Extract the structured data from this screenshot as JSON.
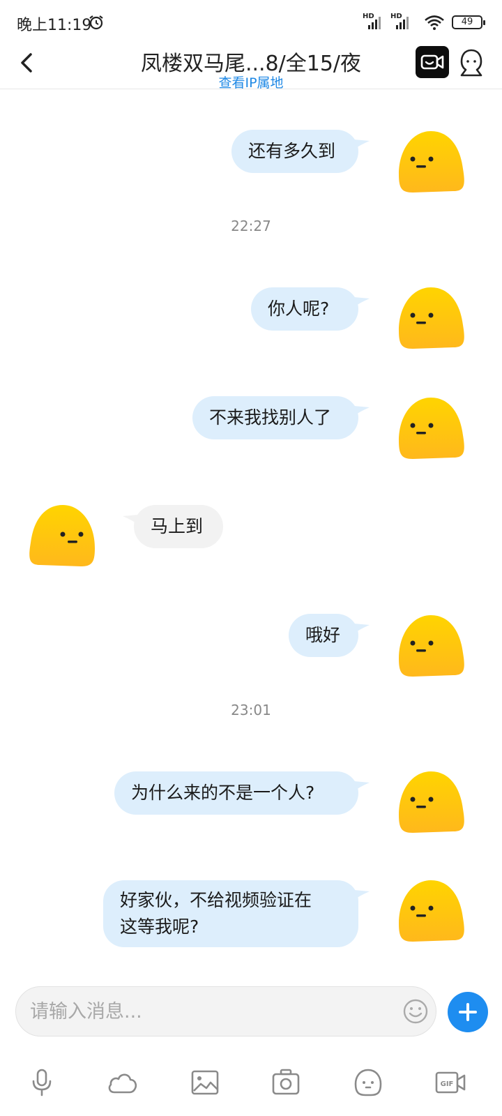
{
  "status_bar": {
    "time": "晚上11:19",
    "signal1_label": "HD",
    "signal2_label": "HD",
    "battery": "49"
  },
  "header": {
    "title": "凤楼双马尾...8/全15/夜",
    "subtitle": "查看IP属地"
  },
  "messages": [
    {
      "sender": "me",
      "text": "还有多久到"
    },
    {
      "type": "time",
      "text": "22:27"
    },
    {
      "sender": "me",
      "text": "你人呢?"
    },
    {
      "sender": "me",
      "text": "不来我找别人了"
    },
    {
      "sender": "other",
      "text": "马上到"
    },
    {
      "sender": "me",
      "text": "哦好"
    },
    {
      "type": "time",
      "text": "23:01"
    },
    {
      "sender": "me",
      "text": "为什么来的不是一个人?"
    },
    {
      "sender": "me",
      "text_line1": "好家伙，不给视频验证在",
      "text_line2": "这等我呢?"
    }
  ],
  "input": {
    "placeholder": "请输入消息..."
  },
  "colors": {
    "accent": "#1e8df0",
    "outgoing_bubble": "#ddeefc",
    "incoming_bubble": "#f2f2f2",
    "avatar": "#ffc400"
  },
  "toolbar_icons": [
    "microphone-icon",
    "cloud-icon",
    "image-icon",
    "camera-icon",
    "sticker-icon",
    "gif-icon"
  ]
}
